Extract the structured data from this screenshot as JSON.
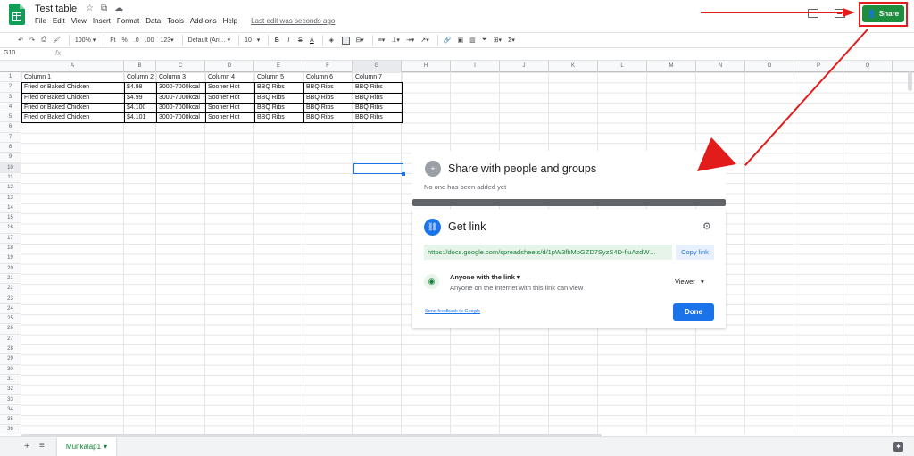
{
  "app": {
    "title": "Test table",
    "title_icons": [
      "☆",
      "⧉",
      "☁"
    ],
    "last_edit": "Last edit was seconds ago",
    "menu": [
      "File",
      "Edit",
      "View",
      "Insert",
      "Format",
      "Data",
      "Tools",
      "Add-ons",
      "Help"
    ],
    "share_label": "Share"
  },
  "toolbar": {
    "zoom": "100%",
    "currency": "Ft",
    "percent": "%",
    "dec_less": ".0",
    "dec_more": ".00",
    "format_more": "123",
    "font": "Default (Ari…",
    "font_size": "10",
    "bold": "B",
    "italic": "I",
    "strike": "S",
    "text_color": "A",
    "sigma": "Σ"
  },
  "formula_bar": {
    "name_box": "G10",
    "fx": "fx"
  },
  "columns": [
    "A",
    "B",
    "C",
    "D",
    "E",
    "F",
    "G",
    "H",
    "I",
    "J",
    "K",
    "L",
    "M",
    "N",
    "O",
    "P",
    "Q"
  ],
  "rows": [
    "1",
    "2",
    "3",
    "4",
    "5",
    "6",
    "7",
    "8",
    "9",
    "10",
    "11",
    "12",
    "13",
    "14",
    "15",
    "16",
    "17",
    "18",
    "19",
    "20",
    "21",
    "22",
    "23",
    "24",
    "25",
    "26",
    "27",
    "28",
    "29",
    "30",
    "31",
    "32",
    "33",
    "34",
    "35",
    "36"
  ],
  "table": {
    "header": [
      "Column 1",
      "Column 2",
      "Column 3",
      "Column 4",
      "Column 5",
      "Column 6",
      "Column 7"
    ],
    "rows": [
      [
        "Fried or Baked Chicken",
        "$4.98",
        "3000-7000kcal",
        "Sooner Hot",
        "BBQ Ribs",
        "BBQ Ribs",
        "BBQ Ribs"
      ],
      [
        "Fried or Baked Chicken",
        "$4.99",
        "3000-7000kcal",
        "Sooner Hot",
        "BBQ Ribs",
        "BBQ Ribs",
        "BBQ Ribs"
      ],
      [
        "Fried or Baked Chicken",
        "$4.100",
        "3000-7000kcal",
        "Sooner Hot",
        "BBQ Ribs",
        "BBQ Ribs",
        "BBQ Ribs"
      ],
      [
        "Fried or Baked Chicken",
        "$4.101",
        "3000-7000kcal",
        "Sooner Hot",
        "BBQ Ribs",
        "BBQ Ribs",
        "BBQ Ribs"
      ]
    ]
  },
  "sheet_tab": "Munkalap1",
  "dialog": {
    "share_title": "Share with people and groups",
    "no_one": "No one has been added yet",
    "get_link": "Get link",
    "url": "https://docs.google.com/spreadsheets/d/1pW3fbMpGZD7SyzS4D-fjuAzdW…",
    "copy_link": "Copy link",
    "anyone": "Anyone with the link",
    "anyone_sub": "Anyone on the internet with this link can view",
    "viewer": "Viewer",
    "feedback": "Send feedback to Google",
    "done": "Done"
  },
  "colors": {
    "accent": "#1a73e8",
    "share_green": "#1e8e3e",
    "annotation_red": "#e21b1b"
  }
}
